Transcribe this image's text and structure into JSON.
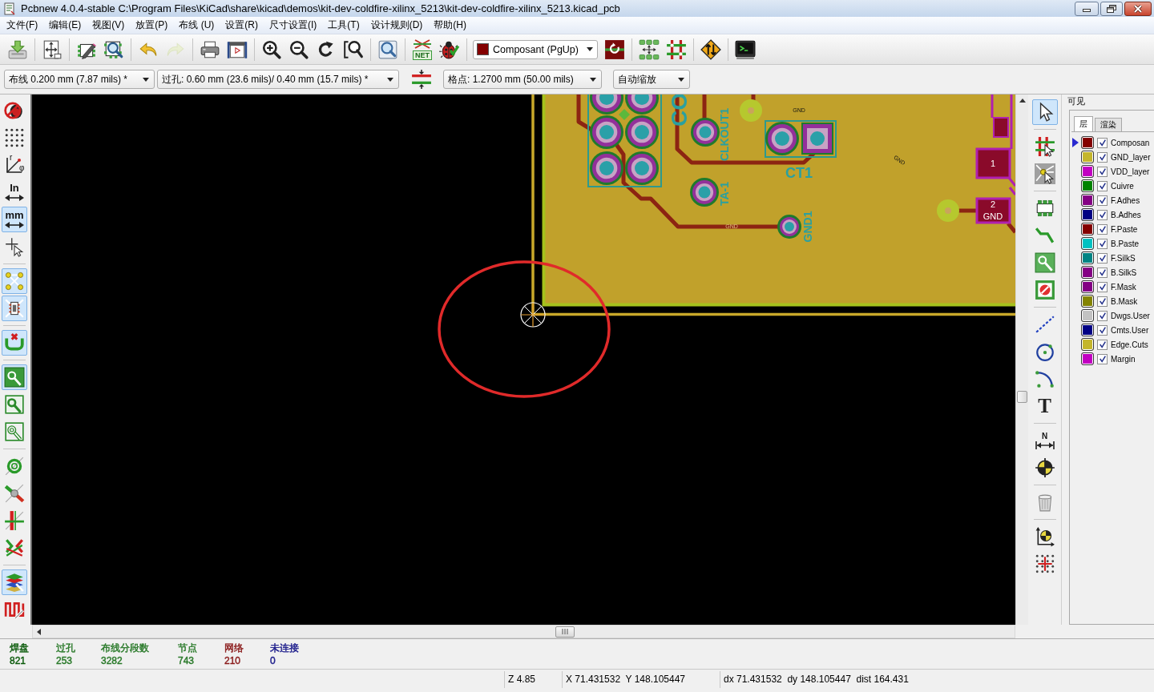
{
  "window": {
    "title": "Pcbnew 4.0.4-stable C:\\Program Files\\KiCad\\share\\kicad\\demos\\kit-dev-coldfire-xilinx_5213\\kit-dev-coldfire-xilinx_5213.kicad_pcb"
  },
  "menu": [
    "文件(F)",
    "编辑(E)",
    "视图(V)",
    "放置(P)",
    "布线 (U)",
    "设置(R)",
    "尺寸设置(I)",
    "工具(T)",
    "设计规则(D)",
    "帮助(H)"
  ],
  "main_toolbar": {
    "groups": [
      [
        {
          "kind": "save",
          "disabled": false
        }
      ],
      [
        {
          "kind": "pagesettings",
          "disabled": false
        }
      ],
      [
        {
          "kind": "moduleeditor",
          "disabled": false
        },
        {
          "kind": "moduleviewer",
          "disabled": false
        }
      ],
      [
        {
          "kind": "undo",
          "disabled": false
        },
        {
          "kind": "redo",
          "disabled": true
        }
      ],
      [
        {
          "kind": "print",
          "disabled": false
        },
        {
          "kind": "plot",
          "disabled": false
        }
      ],
      [
        {
          "kind": "zoomin",
          "disabled": false
        },
        {
          "kind": "zoomout",
          "disabled": false
        },
        {
          "kind": "redraw",
          "disabled": false
        },
        {
          "kind": "zoomfit",
          "disabled": false
        }
      ],
      [
        {
          "kind": "find",
          "disabled": false
        }
      ],
      [
        {
          "kind": "netlist",
          "label": "NET",
          "disabled": false
        },
        {
          "kind": "drc",
          "disabled": false
        }
      ],
      [
        {
          "kind": "layerselect",
          "value": "Composant (PgUp)",
          "color": "#840000",
          "disabled": false
        },
        {
          "kind": "layerpair",
          "disabled": false
        }
      ],
      [
        {
          "kind": "automodule",
          "disabled": false
        },
        {
          "kind": "autotrack",
          "disabled": false
        }
      ],
      [
        {
          "kind": "swap",
          "disabled": false
        }
      ],
      [
        {
          "kind": "console",
          "disabled": false
        }
      ]
    ]
  },
  "options_bar": {
    "track_width": "布线 0.200 mm (7.87 mils) *",
    "via_size": "过孔: 0.60 mm (23.6 mils)/ 0.40 mm (15.7 mils) *",
    "grid": "格点: 1.2700 mm (50.00 mils)",
    "zoom": "自动缩放"
  },
  "left_toolbar": {
    "groups": [
      [
        {
          "kind": "drcoff",
          "selected": false
        },
        {
          "kind": "grid",
          "selected": false
        },
        {
          "kind": "polar",
          "labels": [
            "r",
            "φ"
          ],
          "selected": false
        },
        {
          "kind": "inches",
          "label": "In",
          "selected": false
        },
        {
          "kind": "millimeters",
          "label": "mm",
          "selected": true
        },
        {
          "kind": "cursor",
          "selected": false
        }
      ],
      [
        {
          "kind": "ratsnest",
          "selected": true
        },
        {
          "kind": "modratsnest",
          "selected": true
        }
      ],
      [
        {
          "kind": "autodelete",
          "selected": true
        }
      ],
      [
        {
          "kind": "zonefill",
          "selected": true
        },
        {
          "kind": "zoneoutline",
          "selected": false
        },
        {
          "kind": "zonesketch",
          "selected": false
        }
      ],
      [
        {
          "kind": "padsketch",
          "selected": false
        },
        {
          "kind": "viasketch",
          "selected": false
        },
        {
          "kind": "tracksketch",
          "selected": false
        },
        {
          "kind": "highcontrast",
          "selected": false
        }
      ],
      [
        {
          "kind": "layersmanager",
          "selected": true
        },
        {
          "kind": "microwave",
          "selected": false
        }
      ]
    ]
  },
  "board": {
    "silkscreen_labels": [
      "CO",
      "CLKOUT1",
      "CT1",
      "TA-1",
      "GND1"
    ],
    "net_labels": [
      "GND",
      "GND",
      "GND"
    ],
    "smd_pads": [
      {
        "number": "1"
      },
      {
        "number": "2",
        "net": "GND"
      }
    ]
  },
  "right_toolbar": {
    "groups": [
      [
        {
          "kind": "select",
          "selected": true
        }
      ],
      [
        {
          "kind": "highlightnet",
          "selected": false
        },
        {
          "kind": "localratsnest",
          "selected": false
        }
      ],
      [
        {
          "kind": "module",
          "selected": false
        },
        {
          "kind": "track",
          "selected": false
        },
        {
          "kind": "zone",
          "selected": false
        },
        {
          "kind": "keepout",
          "selected": false
        }
      ],
      [
        {
          "kind": "line",
          "selected": false
        },
        {
          "kind": "circle",
          "selected": false
        },
        {
          "kind": "arc",
          "selected": false
        },
        {
          "kind": "text",
          "label": "T",
          "selected": false
        }
      ],
      [
        {
          "kind": "dimension",
          "label": "N",
          "selected": false
        },
        {
          "kind": "target",
          "selected": false
        }
      ],
      [
        {
          "kind": "delete",
          "selected": false
        }
      ],
      [
        {
          "kind": "origin",
          "selected": false
        },
        {
          "kind": "gridorigin",
          "selected": false
        }
      ]
    ]
  },
  "layers_panel": {
    "title": "可见",
    "tabs": [
      {
        "label": "层",
        "selected": true
      },
      {
        "label": "渲染",
        "selected": false
      }
    ],
    "layers": [
      {
        "name": "Composan",
        "color": "#840000",
        "visible": true,
        "selected": true
      },
      {
        "name": "GND_layer",
        "color": "#c4b62c",
        "visible": true,
        "selected": false
      },
      {
        "name": "VDD_layer",
        "color": "#c200c2",
        "visible": true,
        "selected": false
      },
      {
        "name": "Cuivre",
        "color": "#008400",
        "visible": true,
        "selected": false
      },
      {
        "name": "F.Adhes",
        "color": "#840084",
        "visible": true,
        "selected": false
      },
      {
        "name": "B.Adhes",
        "color": "#000084",
        "visible": true,
        "selected": false
      },
      {
        "name": "F.Paste",
        "color": "#840000",
        "visible": true,
        "selected": false
      },
      {
        "name": "B.Paste",
        "color": "#00c2c2",
        "visible": true,
        "selected": false
      },
      {
        "name": "F.SilkS",
        "color": "#008484",
        "visible": true,
        "selected": false
      },
      {
        "name": "B.SilkS",
        "color": "#840084",
        "visible": true,
        "selected": false
      },
      {
        "name": "F.Mask",
        "color": "#840084",
        "visible": true,
        "selected": false
      },
      {
        "name": "B.Mask",
        "color": "#848400",
        "visible": true,
        "selected": false
      },
      {
        "name": "Dwgs.User",
        "color": "#c2c2c2",
        "visible": true,
        "selected": false
      },
      {
        "name": "Cmts.User",
        "color": "#000084",
        "visible": true,
        "selected": false
      },
      {
        "name": "Edge.Cuts",
        "color": "#c4b62c",
        "visible": true,
        "selected": false
      },
      {
        "name": "Margin",
        "color": "#c200c2",
        "visible": true,
        "selected": false
      }
    ]
  },
  "stats": [
    {
      "label": "焊盘",
      "value": "821",
      "color": "#0a5a0a"
    },
    {
      "label": "过孔",
      "value": "253",
      "color": "#2a7a2a"
    },
    {
      "label": "布线分段数",
      "value": "3282",
      "color": "#2a7a2a"
    },
    {
      "label": "节点",
      "value": "743",
      "color": "#2a7a2a"
    },
    {
      "label": "网络",
      "value": "210",
      "color": "#8a1a1a"
    },
    {
      "label": "未连接",
      "value": "0",
      "color": "#1a1a8a"
    }
  ],
  "status_bar": {
    "fields": [
      "Z 4.85",
      "X 71.431532  Y 148.105447",
      "dx 71.431532  dy 148.105447  dist 164.431"
    ]
  }
}
